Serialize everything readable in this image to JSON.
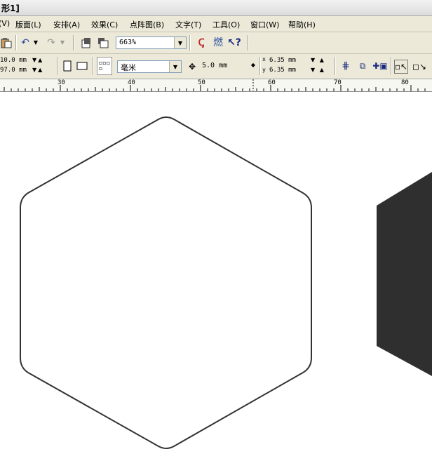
{
  "window": {
    "title_fragment": "形1]"
  },
  "menu": {
    "items": [
      {
        "label": "(V)"
      },
      {
        "label": "版面(L)"
      },
      {
        "label": "安排(A)"
      },
      {
        "label": "效果(C)"
      },
      {
        "label": "点阵图(B)"
      },
      {
        "label": "文字(T)"
      },
      {
        "label": "工具(O)"
      },
      {
        "label": "窗口(W)"
      },
      {
        "label": "帮助(H)"
      }
    ]
  },
  "toolbar": {
    "zoom_value": "663%",
    "paste_icon": "paste-icon",
    "undo_icon": "undo-icon",
    "redo_icon": "redo-icon",
    "import_icon": "import-icon",
    "export_icon": "export-icon",
    "corel_icon": "corel-launcher-icon",
    "help_icon": "whats-this-help-icon"
  },
  "property_bar": {
    "width_value": "10.0 mm",
    "height_value": "97.0 mm",
    "units": "毫米",
    "nudge_value": "5.0 mm",
    "duplicate_x": "6.35 mm",
    "duplicate_y": "6.35 mm",
    "duplicate_x_label": "x",
    "duplicate_y_label": "y"
  },
  "ruler": {
    "labels": [
      "30",
      "40",
      "50",
      "60",
      "70",
      "80"
    ]
  },
  "colors": {
    "hex_stroke": "#333333",
    "filled_shape": "#2f2f2f",
    "chrome": "#ece9d8"
  }
}
